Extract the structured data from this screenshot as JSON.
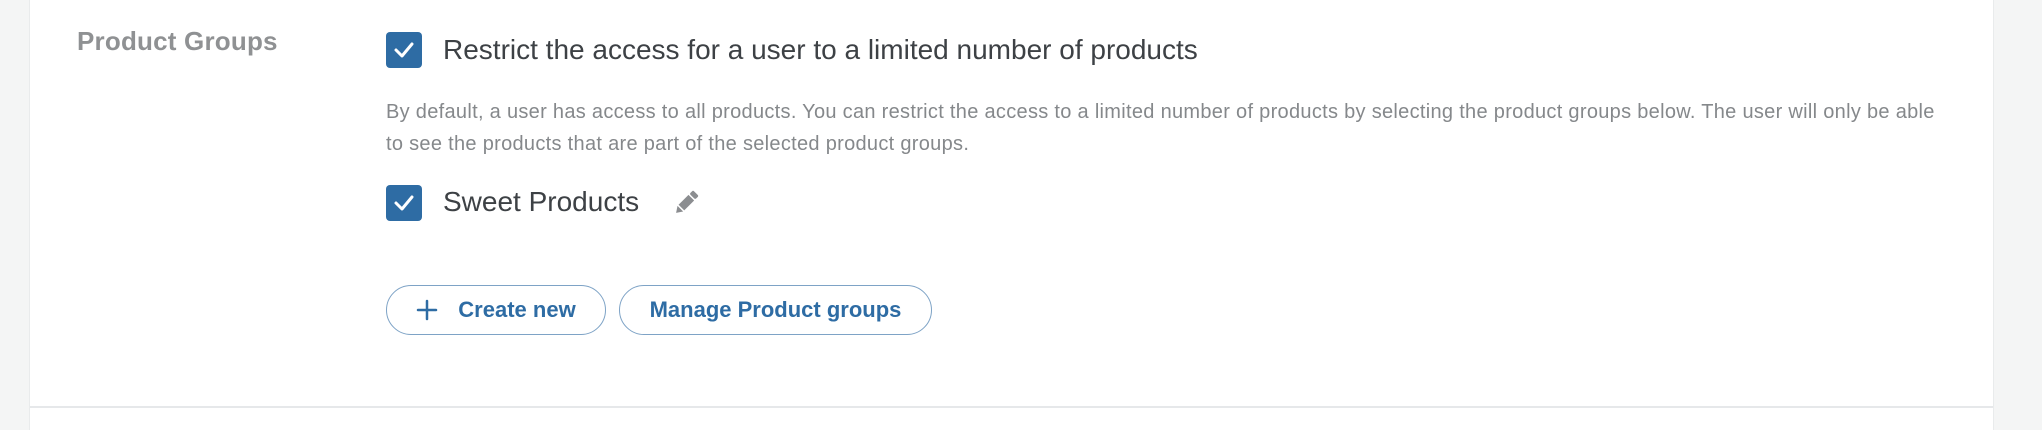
{
  "section": {
    "label": "Product Groups"
  },
  "restrict": {
    "checked": true,
    "label": "Restrict the access for a user to a limited number of products"
  },
  "description": "By default, a user has access to all products. You can restrict the access to a limited number of products by selecting the product groups below. The user will only be able to see the products that are part of the selected product groups.",
  "groups": [
    {
      "checked": true,
      "label": "Sweet Products",
      "icon": "pencil-icon"
    }
  ],
  "actions": {
    "create_label": "Create new",
    "create_icon": "plus-icon",
    "manage_label": "Manage Product groups"
  },
  "colors": {
    "accent": "#2e6ca4",
    "label_gray": "#8f9193",
    "text_dark": "#3d4145",
    "text_muted": "#85888b",
    "page_bg": "#f4f5f5"
  }
}
